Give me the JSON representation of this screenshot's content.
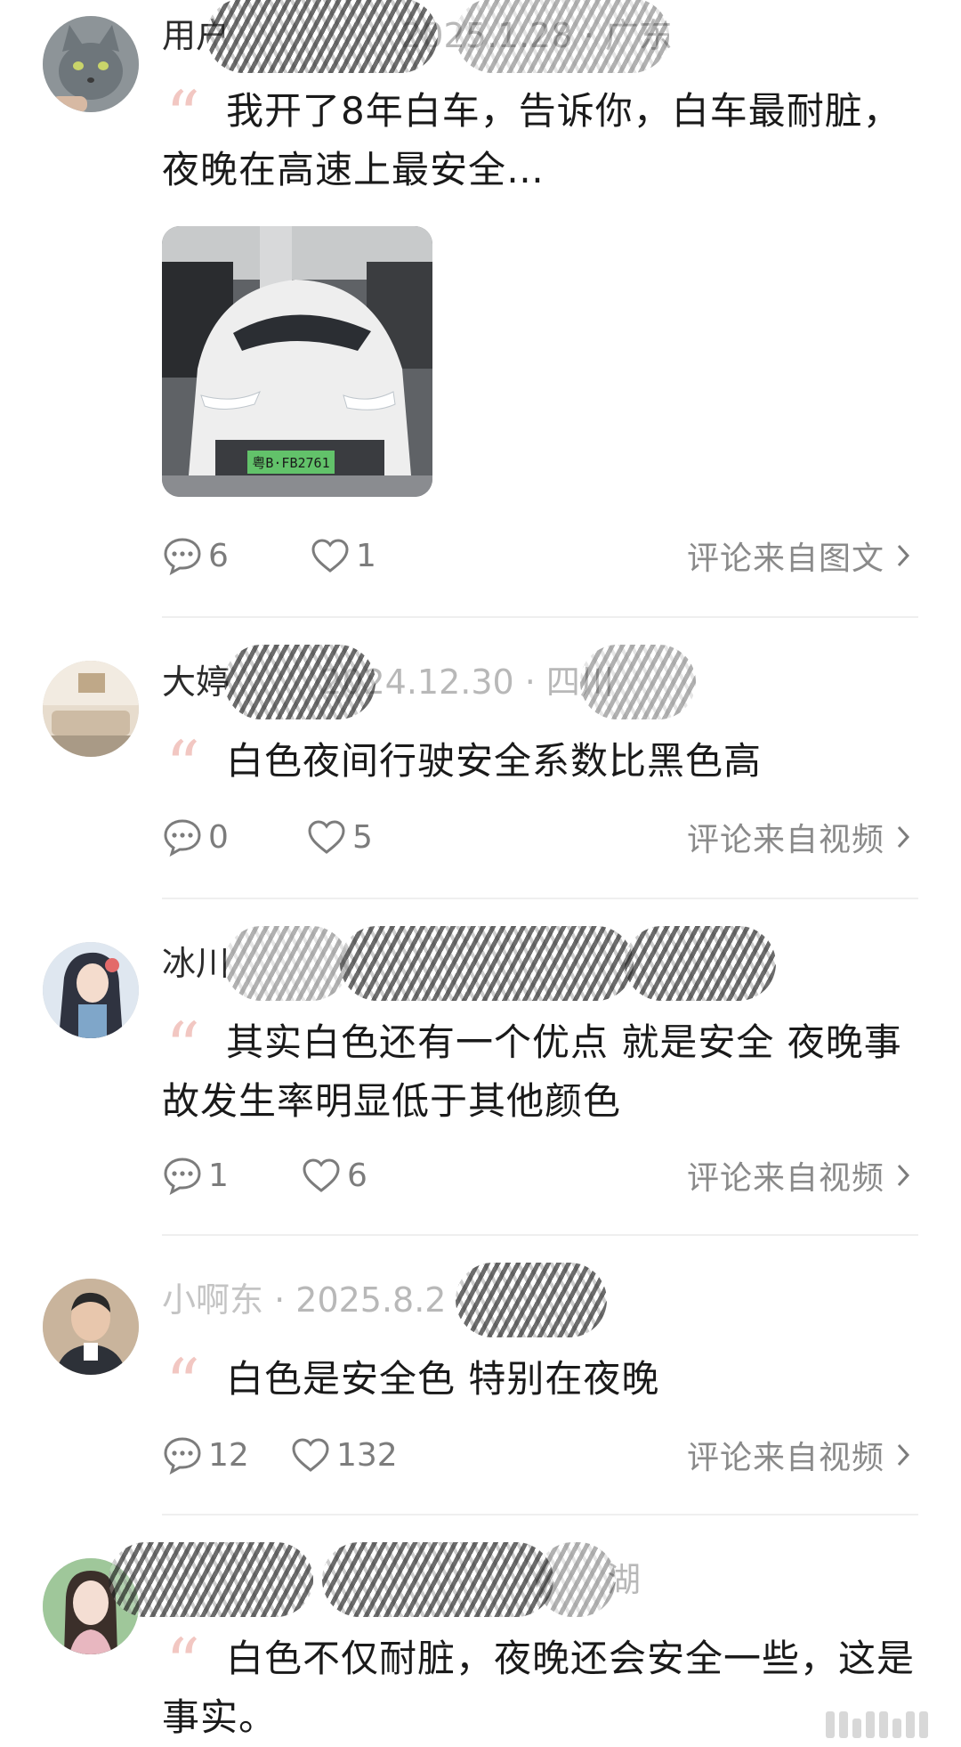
{
  "comments": [
    {
      "header_visible": "用户",
      "header_blur": "2025.1.28 · 广东",
      "text": "我开了8年白车，告诉你，白车最耐脏，夜晚在高速上最安全…",
      "has_photo": true,
      "photo_plate": "粤B·FB2761",
      "replies": "6",
      "likes": "1",
      "source": "评论来自图文"
    },
    {
      "header_visible": "大婷",
      "header_blur": "2024.12.30 · 四川",
      "text": "白色夜间行驶安全系数比黑色高",
      "replies": "0",
      "likes": "5",
      "source": "评论来自视频"
    },
    {
      "header_visible": "冰川",
      "header_blur": "",
      "text": "其实白色还有一个优点 就是安全 夜晚事故发生率明显低于其他颜色",
      "replies": "1",
      "likes": "6",
      "source": "评论来自视频"
    },
    {
      "header_visible": "小啊东",
      "header_blur": "· 2025.8.2",
      "text": "白色是安全色  特别在夜晚",
      "replies": "12",
      "likes": "132",
      "source": "评论来自视频"
    },
    {
      "header_visible": "",
      "header_blur": "湖",
      "text": "白色不仅耐脏，夜晚还会安全一些，这是事实。",
      "replies": "",
      "likes": "",
      "source": ""
    }
  ],
  "colors": {
    "quote_mark": "#f2c7c2",
    "meta_gray": "#8a8a8a",
    "text": "#1a1a1a",
    "divider": "#efefef"
  },
  "icons": [
    "reply-icon",
    "heart-icon",
    "chevron-right-icon",
    "quote-icon"
  ]
}
